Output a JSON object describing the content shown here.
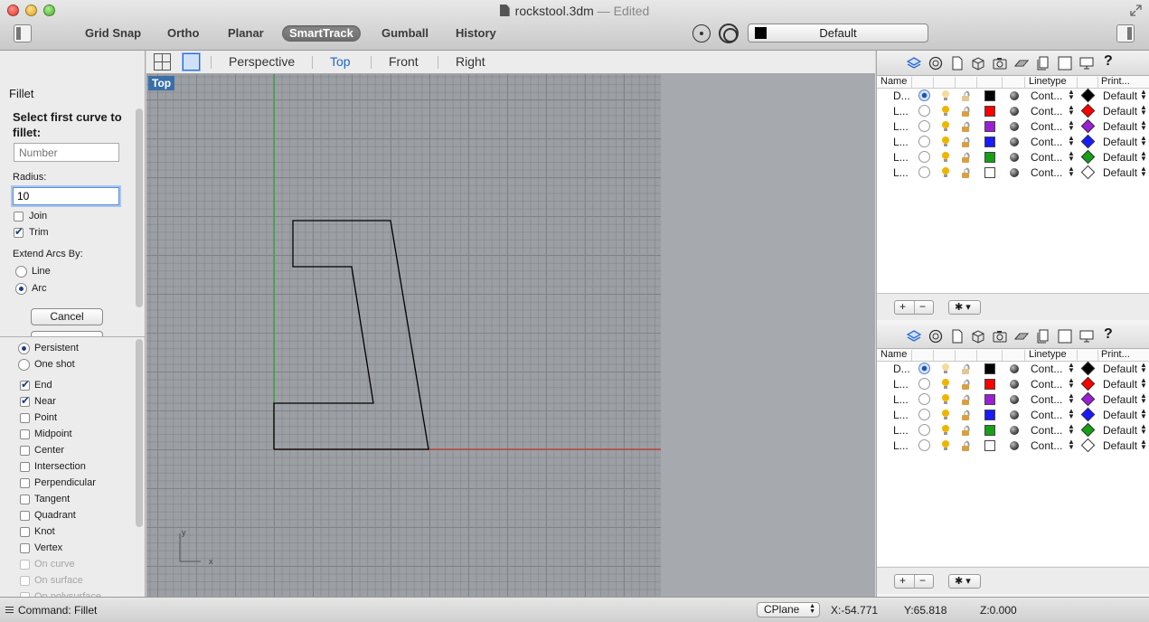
{
  "window": {
    "title": "rockstool.3dm",
    "edited": "— Edited"
  },
  "toolbar": {
    "grid_snap": "Grid Snap",
    "ortho": "Ortho",
    "planar": "Planar",
    "smarttrack": "SmartTrack",
    "gumball": "Gumball",
    "history": "History",
    "layer_name": "Default",
    "layer_color": "#000000"
  },
  "viewport_tabs": {
    "perspective": "Perspective",
    "top": "Top",
    "front": "Front",
    "right": "Right"
  },
  "command_panel": {
    "title": "Fillet",
    "prompt": "Select first curve to fillet:",
    "number_placeholder": "Number",
    "radius_label": "Radius:",
    "radius_value": "10",
    "join_label": "Join",
    "join_checked": false,
    "trim_label": "Trim",
    "trim_checked": true,
    "extend_label": "Extend Arcs By:",
    "line_label": "Line",
    "arc_label": "Arc",
    "cancel_label": "Cancel"
  },
  "osnap": {
    "persistent": "Persistent",
    "one_shot": "One shot",
    "items": [
      {
        "label": "End",
        "checked": true
      },
      {
        "label": "Near",
        "checked": true
      },
      {
        "label": "Point",
        "checked": false
      },
      {
        "label": "Midpoint",
        "checked": false
      },
      {
        "label": "Center",
        "checked": false
      },
      {
        "label": "Intersection",
        "checked": false
      },
      {
        "label": "Perpendicular",
        "checked": false
      },
      {
        "label": "Tangent",
        "checked": false
      },
      {
        "label": "Quadrant",
        "checked": false
      },
      {
        "label": "Knot",
        "checked": false
      },
      {
        "label": "Vertex",
        "checked": false
      },
      {
        "label": "On curve",
        "checked": false,
        "disabled": true
      },
      {
        "label": "On surface",
        "checked": false,
        "disabled": true
      },
      {
        "label": "On polysurface",
        "checked": false,
        "disabled": true
      }
    ]
  },
  "viewport": {
    "label": "Top",
    "axis_y": "y",
    "axis_x": "x"
  },
  "layers_panel": {
    "columns": {
      "name": "Name",
      "linetype": "Linetype",
      "print": "Print..."
    },
    "rows": [
      {
        "name": "D...",
        "current": true,
        "color": "#000000",
        "linetype": "Cont...",
        "print_color": "#000000",
        "print_width": "Default"
      },
      {
        "name": "L...",
        "current": false,
        "color": "#ff0000",
        "linetype": "Cont...",
        "print_color": "#ff0000",
        "print_width": "Default"
      },
      {
        "name": "L...",
        "current": false,
        "color": "#9b1fd6",
        "linetype": "Cont...",
        "print_color": "#9b1fd6",
        "print_width": "Default"
      },
      {
        "name": "L...",
        "current": false,
        "color": "#1a1aff",
        "linetype": "Cont...",
        "print_color": "#1a1aff",
        "print_width": "Default"
      },
      {
        "name": "L...",
        "current": false,
        "color": "#15a015",
        "linetype": "Cont...",
        "print_color": "#15a015",
        "print_width": "Default"
      },
      {
        "name": "L...",
        "current": false,
        "color": "#ffffff",
        "linetype": "Cont...",
        "print_color": "#ffffff",
        "print_width": "Default"
      }
    ]
  },
  "status_bar": {
    "command": "Command: Fillet",
    "cplane": "CPlane",
    "x": "X:-54.771",
    "y": "Y:65.818",
    "z": "Z:0.000"
  }
}
